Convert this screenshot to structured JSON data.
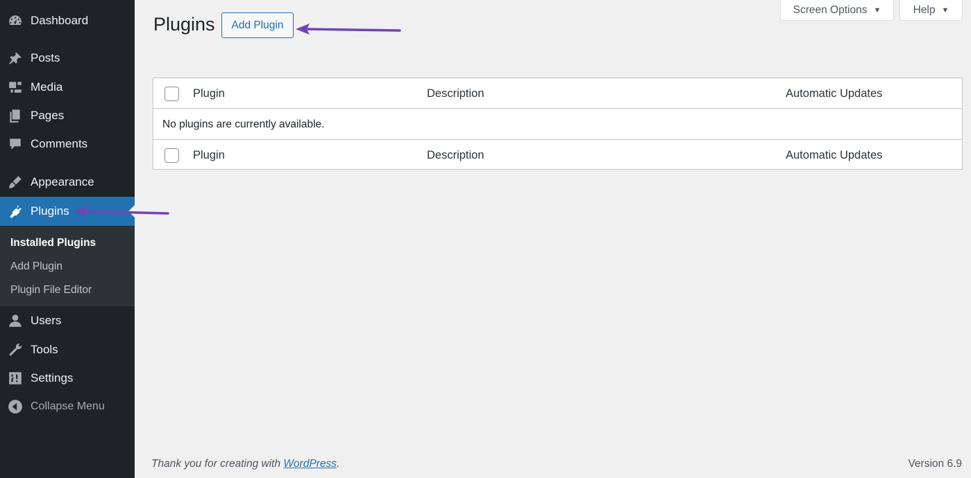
{
  "sidebar": {
    "items": [
      {
        "label": "Dashboard",
        "icon": "dashboard-icon"
      },
      {
        "label": "Posts",
        "icon": "pin-icon"
      },
      {
        "label": "Media",
        "icon": "media-icon"
      },
      {
        "label": "Pages",
        "icon": "pages-icon"
      },
      {
        "label": "Comments",
        "icon": "comment-icon"
      },
      {
        "label": "Appearance",
        "icon": "brush-icon"
      },
      {
        "label": "Plugins",
        "icon": "plugin-icon"
      },
      {
        "label": "Users",
        "icon": "user-icon"
      },
      {
        "label": "Tools",
        "icon": "wrench-icon"
      },
      {
        "label": "Settings",
        "icon": "settings-icon"
      }
    ],
    "submenu": [
      "Installed Plugins",
      "Add Plugin",
      "Plugin File Editor"
    ],
    "collapse_label": "Collapse Menu",
    "active_color": "#2271b1"
  },
  "header": {
    "screen_options": "Screen Options",
    "help": "Help",
    "title": "Plugins",
    "add_plugin": "Add Plugin"
  },
  "table": {
    "columns": [
      "Plugin",
      "Description",
      "Automatic Updates"
    ],
    "empty_message": "No plugins are currently available."
  },
  "footer": {
    "thanks_prefix": "Thank you for creating with ",
    "thanks_link": "WordPress",
    "thanks_suffix": ".",
    "version": "Version 6.9"
  },
  "annotation_color": "#7044b8"
}
